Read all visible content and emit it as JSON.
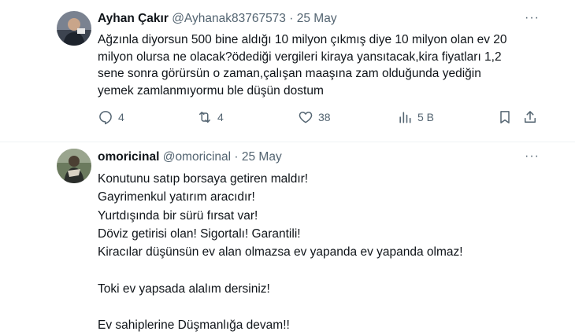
{
  "tweet1": {
    "name": "Ayhan Çakır",
    "handle": "@Ayhanak83767573",
    "separator": "·",
    "date": "25 May",
    "text": "Ağzınla diyorsun 500 bine aldığı 10 milyon çıkmış diye 10 milyon olan ev 20\nmilyon olursa ne olacak?ödediği vergileri kiraya yansıtacak,kira fiyatları 1,2\nsene sonra görürsün o zaman,çalışan maaşına zam olduğunda yediğin\nyemek zamlanmıyormu ble düşün dostum",
    "more": "···",
    "actions": {
      "reply_icon": "reply-icon",
      "reply_count": "4",
      "retweet_icon": "retweet-icon",
      "retweet_count": "4",
      "like_icon": "heart-icon",
      "like_count": "38",
      "views_icon": "views-chart-icon",
      "views_count": "5 B",
      "bookmark_icon": "bookmark-icon",
      "share_icon": "share-icon"
    }
  },
  "tweet2": {
    "name": "omoricinal",
    "handle": "@omoricinal",
    "separator": "·",
    "date": "25 May",
    "text": "Konutunu satıp borsaya getiren maldır!\nGayrimenkul yatırım aracıdır!\nYurtdışında bir sürü fırsat var!\nDöviz getirisi olan! Sigortalı! Garantili!\nKiracılar düşünsün ev alan olmazsa ev yapanda ev yapanda olmaz!\n\nToki ev yapsada alalım dersiniz!\n\nEv sahiplerine Düşmanlığa devam!!",
    "more": "···"
  },
  "colors": {
    "text_primary": "#0f1419",
    "text_secondary": "#536471",
    "divider": "#eff3f4"
  }
}
